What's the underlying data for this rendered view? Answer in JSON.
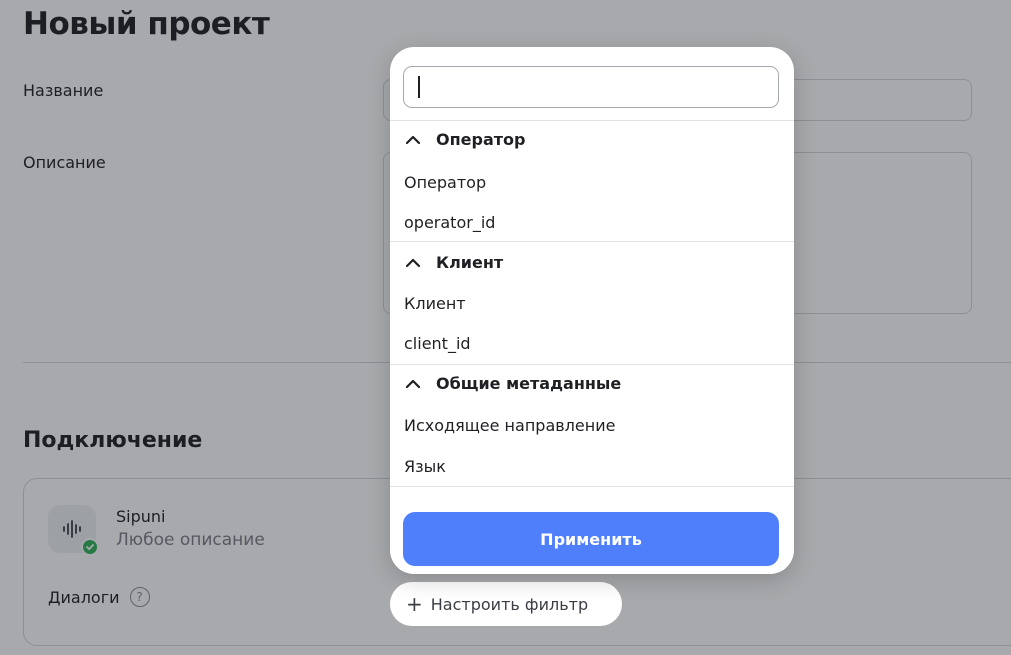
{
  "page": {
    "title": "Новый проект",
    "name_label": "Название",
    "description_label": "Описание",
    "connection_title": "Подключение",
    "connection": {
      "name": "Sipuni",
      "description": "Любое описание",
      "icon": "audio-waveform-icon",
      "status": "connected"
    },
    "dialogs_label": "Диалоги",
    "help_symbol": "?",
    "filter_button": {
      "plus": "+",
      "label": "Настроить фильтр"
    }
  },
  "popup": {
    "search": {
      "value": "",
      "placeholder": ""
    },
    "groups": [
      {
        "title": "Оператор",
        "expanded": true,
        "items": [
          "Оператор",
          "operator_id"
        ]
      },
      {
        "title": "Клиент",
        "expanded": true,
        "items": [
          "Клиент",
          "client_id"
        ]
      },
      {
        "title": "Общие метаданные",
        "expanded": true,
        "items": [
          "Исходящее направление",
          "Язык"
        ]
      }
    ],
    "apply_label": "Применить"
  },
  "colors": {
    "accent": "#4f7ffa",
    "success": "#2fb45a",
    "overlay": "rgba(25,28,38,0.38)"
  }
}
